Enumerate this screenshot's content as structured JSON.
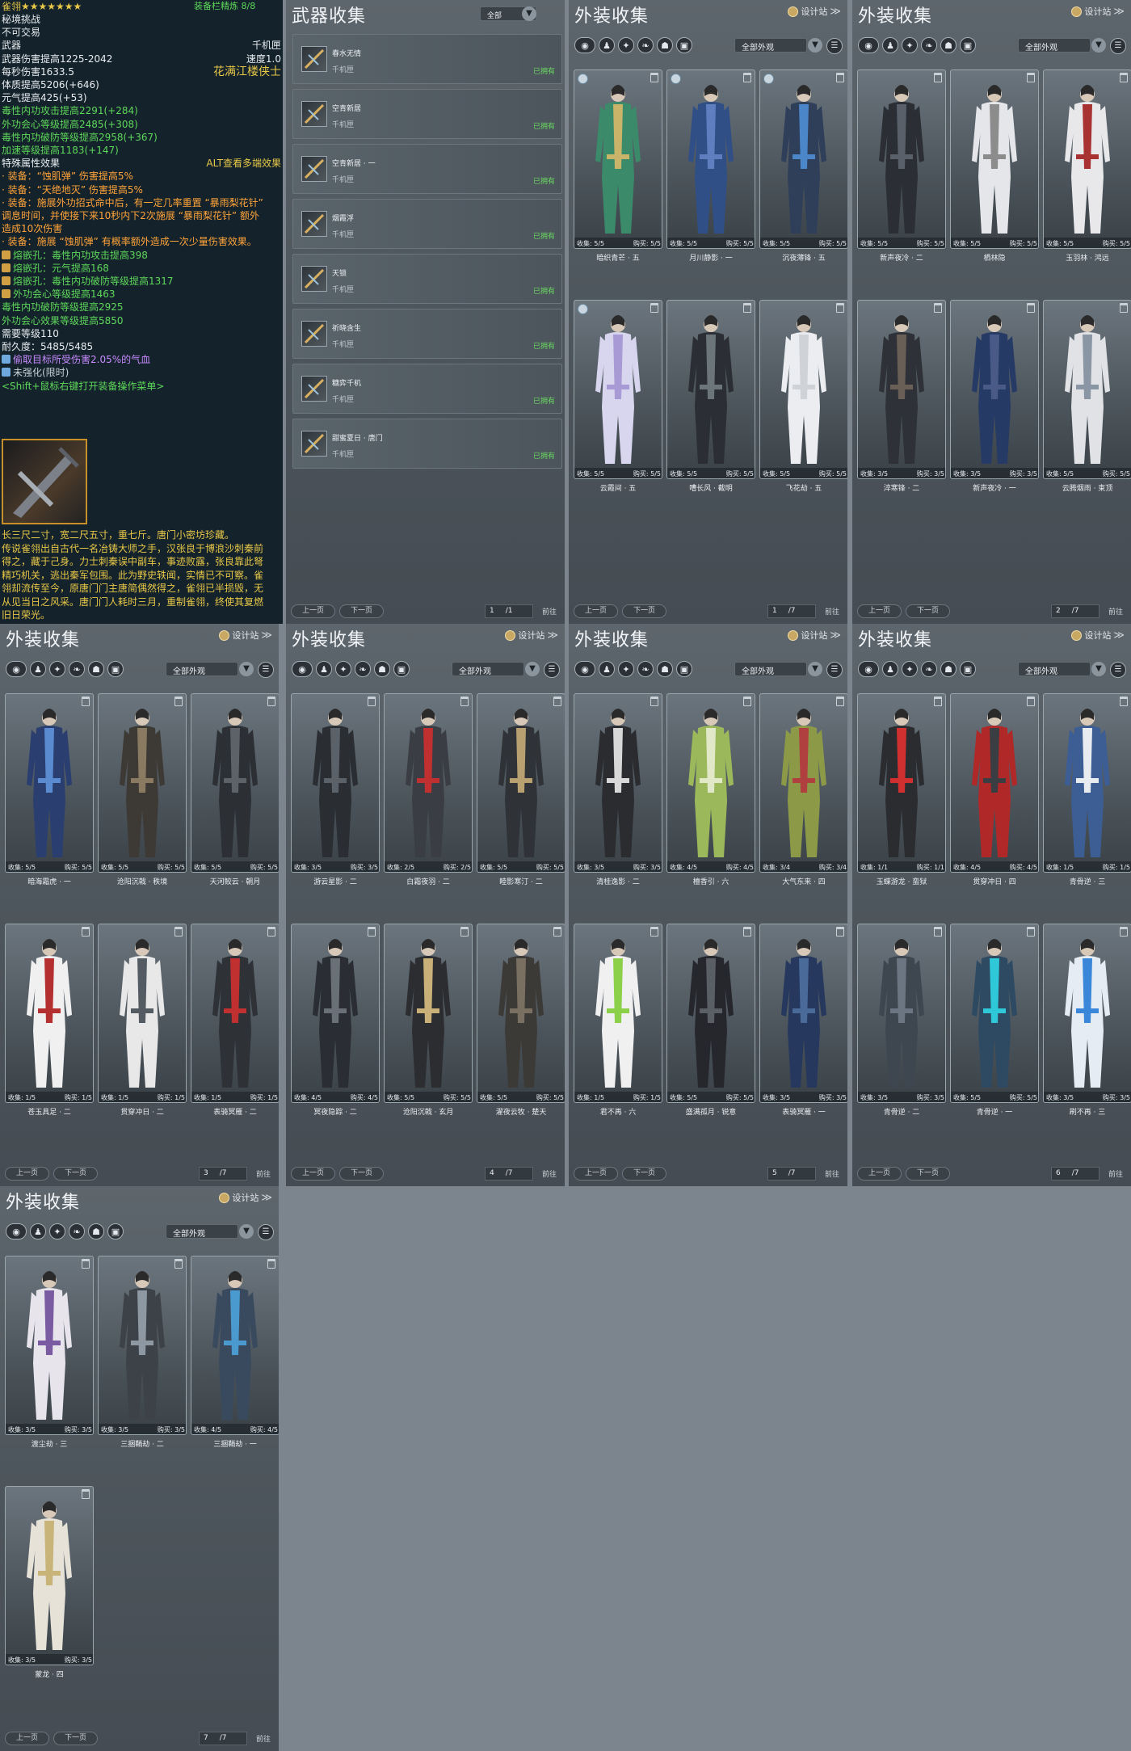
{
  "tooltip": {
    "header": "雀翎★★★★★★★",
    "header_right": "装备栏精炼 8/8",
    "lines": [
      {
        "t": "秘境挑战",
        "c": "c-w"
      },
      {
        "t": "不可交易",
        "c": "c-w"
      },
      {
        "t": "武器",
        "r": "千机匣",
        "c": "c-w"
      },
      {
        "t": "武器伤害提高1225-2042",
        "r": "速度1.0",
        "c": "c-w"
      },
      {
        "t": "每秒伤害1633.5",
        "r": "花满江楼侠士",
        "c": "c-w"
      },
      {
        "t": "体质提高5206(+646)",
        "c": "c-w"
      },
      {
        "t": "元气提高425(+53)",
        "c": "c-w"
      },
      {
        "t": "毒性内功攻击提高2291(+284)",
        "c": "c-g"
      },
      {
        "t": "外功会心等级提高2485(+308)",
        "c": "c-g"
      },
      {
        "t": "毒性内功破防等级提高2958(+367)",
        "c": "c-g"
      },
      {
        "t": "加速等级提高1183(+147)",
        "c": "c-g"
      },
      {
        "t": "特殊属性效果",
        "r": "ALT查看多端效果",
        "c": "c-w"
      },
      {
        "t": "· 装备：“蚀肌弹” 伤害提高5%",
        "c": "c-o"
      },
      {
        "t": "· 装备：“天绝地灭” 伤害提高5%",
        "c": "c-o"
      },
      {
        "t": "· 装备：施展外功招式命中后，有一定几率重置 “暴雨梨花针”",
        "c": "c-o"
      },
      {
        "t": "调息时间，并使接下来10秒内下2次施展 “暴雨梨花针” 额外",
        "c": "c-o"
      },
      {
        "t": "造成10次伤害",
        "c": "c-o"
      },
      {
        "t": "· 装备：施展 “蚀肌弹” 有概率额外造成一次少量伤害效果。",
        "c": "c-o"
      },
      {
        "t": "熔嵌孔：毒性内功攻击提高398",
        "c": "c-g",
        "gem": true
      },
      {
        "t": "熔嵌孔：元气提高168",
        "c": "c-g",
        "gem": true
      },
      {
        "t": "熔嵌孔：毒性内功破防等级提高1317",
        "c": "c-g",
        "gem": true
      },
      {
        "t": "外功会心等级提高1463",
        "c": "c-g",
        "gem": true
      },
      {
        "t": "   毒性内功破防等级提高2925",
        "c": "c-g"
      },
      {
        "t": "   外功会心效果等级提高5850",
        "c": "c-g"
      },
      {
        "t": "需要等级110",
        "c": "c-w"
      },
      {
        "t": "耐久度：5485/5485",
        "c": "c-w"
      },
      {
        "t": "偷取目标所受伤害2.05%的气血",
        "c": "c-pu",
        "gem": true
      },
      {
        "t": "未强化(限时)",
        "c": "c-gr",
        "gem": true
      },
      {
        "t": "<Shift+鼠标右键打开装备操作菜单>",
        "c": "c-g"
      }
    ],
    "desc": [
      "长三尺二寸，宽二尺五寸，重七斤。唐门小密坊珍藏。",
      "传说雀翎出自古代一名冶铸大师之手，汉张良于博浪沙刺秦前",
      "得之，藏于己身。力士刺秦误中副车，事迹败露，张良靠此弩",
      "精巧机关，逃出秦军包围。此为野史轶闻，实情已不可察。雀",
      "翎却流传至今，原唐门门主唐简偶然得之，雀翎已半损毁，无",
      "从见当日之风采。唐门门人耗时三月，重制雀翎，终使其复燃",
      "旧日荣光。"
    ]
  },
  "weapons": {
    "title": "武器收集",
    "filter": "全部",
    "items": [
      {
        "name": "春水无情",
        "type": "千机匣",
        "status": "已拥有"
      },
      {
        "name": "空青新居",
        "type": "千机匣",
        "status": "已拥有"
      },
      {
        "name": "空青新居 · 一",
        "type": "千机匣",
        "status": "已拥有"
      },
      {
        "name": "烟霞浮",
        "type": "千机匣",
        "status": "已拥有"
      },
      {
        "name": "天锁",
        "type": "千机匣",
        "status": "已拥有"
      },
      {
        "name": "祈晓含生",
        "type": "千机匣",
        "status": "已拥有"
      },
      {
        "name": "糖弈千机",
        "type": "千机匣",
        "status": "已拥有"
      },
      {
        "name": "甜蜜夏日 · 唐门",
        "type": "千机匣",
        "status": "已拥有"
      }
    ],
    "prev": "上一页",
    "next": "下一页",
    "page": "1",
    "total": "1",
    "jump": "前往"
  },
  "common": {
    "title": "外装收集",
    "design": "设计站",
    "filter": "全部外观",
    "prev": "上一页",
    "next": "下一页",
    "jump": "前往",
    "total": "/7",
    "collect": "收集:",
    "buy": "购买:"
  },
  "outfits": [
    {
      "page": "1",
      "items": [
        {
          "name": "暗织青芒 · 五",
          "c": "5/5",
          "b": "5/5",
          "col": "#3b8a6a",
          "acc": "#c9b46a",
          "badge": true
        },
        {
          "name": "月川静影 · 一",
          "c": "5/5",
          "b": "5/5",
          "col": "#2f4f86",
          "acc": "#5e7ec0",
          "badge": true
        },
        {
          "name": "沉夜薄锋 · 五",
          "c": "5/5",
          "b": "5/5",
          "col": "#2f3f5a",
          "acc": "#4a86c8",
          "badge": true
        },
        {
          "name": "云霞间 · 五",
          "c": "5/5",
          "b": "5/5",
          "col": "#d8d6ee",
          "acc": "#a89ad4",
          "badge": true
        },
        {
          "name": "嘈长风 · 截明",
          "c": "5/5",
          "b": "5/5",
          "col": "#2b2f35",
          "acc": "#6c747c"
        },
        {
          "name": "飞花劫 · 五",
          "c": "5/5",
          "b": "5/5",
          "col": "#ebedf0",
          "acc": "#cfd3d8"
        }
      ]
    },
    {
      "page": "2",
      "items": [
        {
          "name": "新声夜冷 · 二",
          "c": "5/5",
          "b": "5/5",
          "col": "#2b2f35",
          "acc": "#59606a"
        },
        {
          "name": "栖林隐",
          "c": "5/5",
          "b": "5/5",
          "col": "#e4e6ea",
          "acc": "#8c8c8c"
        },
        {
          "name": "玉羽林 · 鸿远",
          "c": "5/5",
          "b": "5/5",
          "col": "#e8e8ea",
          "acc": "#a83232"
        },
        {
          "name": "淬寒锋 · 二",
          "c": "3/5",
          "b": "3/5",
          "col": "#2e3238",
          "acc": "#6a5f56"
        },
        {
          "name": "新声夜冷 · 一",
          "c": "3/5",
          "b": "3/5",
          "col": "#263a66",
          "acc": "#4a5a88"
        },
        {
          "name": "云腾烟雨 · 束顶",
          "c": "5/5",
          "b": "5/5",
          "col": "#e0e2e6",
          "acc": "#8a96a4"
        }
      ]
    },
    {
      "page": "3",
      "items": [
        {
          "name": "暗海霜虎 · 一",
          "c": "5/5",
          "b": "5/5",
          "col": "#2a3f70",
          "acc": "#5a8ad0"
        },
        {
          "name": "沧阳沉戟 · 秩境",
          "c": "5/5",
          "b": "5/5",
          "col": "#3d3a36",
          "acc": "#8a7a62"
        },
        {
          "name": "天河鲛云 · 朝月",
          "c": "5/5",
          "b": "5/5",
          "col": "#2c2f34",
          "acc": "#5c6268"
        },
        {
          "name": "苍玉具足 · 二",
          "c": "1/5",
          "b": "1/5",
          "col": "#f0f0f0",
          "acc": "#b43030"
        },
        {
          "name": "贯穿冲日 · 二",
          "c": "1/5",
          "b": "1/5",
          "col": "#e8e8e8",
          "acc": "#555b62"
        },
        {
          "name": "表骑冥雁 · 二",
          "c": "1/5",
          "b": "1/5",
          "col": "#2e3136",
          "acc": "#c03030"
        }
      ]
    },
    {
      "page": "4",
      "items": [
        {
          "name": "游云星影 · 二",
          "c": "3/5",
          "b": "3/5",
          "col": "#2a2e33",
          "acc": "#5a6168"
        },
        {
          "name": "白霜夜羽 · 二",
          "c": "2/5",
          "b": "2/5",
          "col": "#3a3e44",
          "acc": "#c03030"
        },
        {
          "name": "睦影寒汀 · 二",
          "c": "5/5",
          "b": "5/5",
          "col": "#2f3338",
          "acc": "#b8a070"
        },
        {
          "name": "冥夜隐踪 · 二",
          "c": "4/5",
          "b": "4/5",
          "col": "#2a2e34",
          "acc": "#6a7078"
        },
        {
          "name": "沧阳沉戟 · 玄月",
          "c": "5/5",
          "b": "5/5",
          "col": "#2c2d31",
          "acc": "#c8b078"
        },
        {
          "name": "濯夜云牧 · 楚天",
          "c": "5/5",
          "b": "5/5",
          "col": "#3c3a37",
          "acc": "#7a7062"
        }
      ]
    },
    {
      "page": "5",
      "items": [
        {
          "name": "清桂逸影 · 二",
          "c": "3/5",
          "b": "3/5",
          "col": "#2a2c30",
          "acc": "#d8d8d8"
        },
        {
          "name": "檀香引 · 六",
          "c": "4/5",
          "b": "4/5",
          "col": "#9bb85a",
          "acc": "#e0e8c8"
        },
        {
          "name": "大气东来 · 四",
          "c": "3/4",
          "b": "3/4",
          "col": "#8c9a48",
          "acc": "#b04040"
        },
        {
          "name": "君不再 · 六",
          "c": "1/5",
          "b": "1/5",
          "col": "#f0f0f0",
          "acc": "#8bd048"
        },
        {
          "name": "盛满孤月 · 锐意",
          "c": "5/5",
          "b": "5/5",
          "col": "#25272c",
          "acc": "#5a5f66"
        },
        {
          "name": "表骑冥雁 · 一",
          "c": "3/5",
          "b": "3/5",
          "col": "#26385e",
          "acc": "#4a6a9a"
        }
      ]
    },
    {
      "page": "6",
      "items": [
        {
          "name": "玉蝶游龙 · 蛮狱",
          "c": "1/1",
          "b": "1/1",
          "col": "#2a2c30",
          "acc": "#d03030"
        },
        {
          "name": "贯穿冲日 · 四",
          "c": "4/5",
          "b": "4/5",
          "col": "#b02828",
          "acc": "#3a3d42"
        },
        {
          "name": "青骨逆 · 三",
          "c": "1/5",
          "b": "1/5",
          "col": "#3c5e94",
          "acc": "#e8ecf0"
        },
        {
          "name": "青骨逆 · 二",
          "c": "3/5",
          "b": "3/5",
          "col": "#3e4650",
          "acc": "#6c7682"
        },
        {
          "name": "青骨逆 · 一",
          "c": "5/5",
          "b": "5/5",
          "col": "#2e4a62",
          "acc": "#2ec8d8"
        },
        {
          "name": "刷不再 · 三",
          "c": "3/5",
          "b": "3/5",
          "col": "#e6ecf4",
          "acc": "#3a86d8"
        }
      ]
    },
    {
      "page": "7",
      "items": [
        {
          "name": "渡尘劫 · 三",
          "c": "3/5",
          "b": "3/5",
          "col": "#e8e4ec",
          "acc": "#7a5aa0"
        },
        {
          "name": "三捆鞘劫 · 二",
          "c": "3/5",
          "b": "3/5",
          "col": "#3c4248",
          "acc": "#8e98a2"
        },
        {
          "name": "三捆鞘劫 · 一",
          "c": "4/5",
          "b": "4/5",
          "col": "#3a4a5e",
          "acc": "#4a9ad0"
        },
        {
          "name": "蒙龙 · 四",
          "c": "3/5",
          "b": "3/5",
          "col": "#e6e2d8",
          "acc": "#c8b478"
        }
      ]
    }
  ]
}
